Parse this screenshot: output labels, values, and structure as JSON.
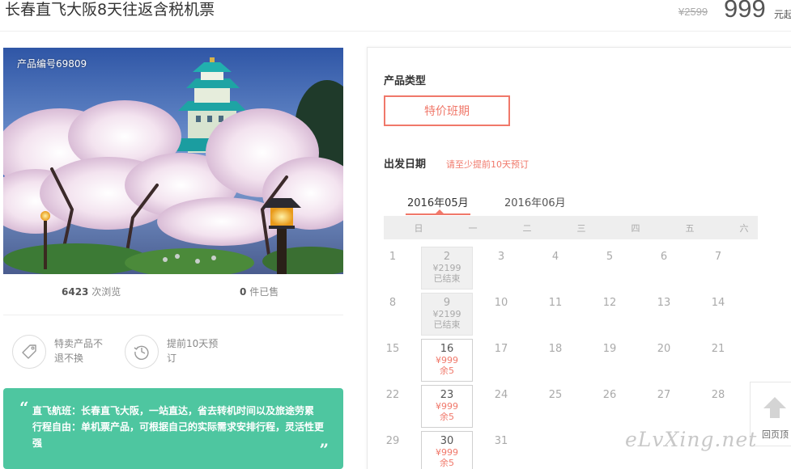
{
  "header": {
    "title": "长春直飞大阪8天往返含税机票",
    "price_original": "¥2599",
    "price_current": "999",
    "price_unit": "元起"
  },
  "gallery": {
    "product_id": "产品编号69809"
  },
  "stats": {
    "views_count": "6423",
    "views_label": "次浏览",
    "sold_count": "0",
    "sold_label": "件已售"
  },
  "features": [
    {
      "icon": "tag-icon",
      "text": "特卖产品不退不换"
    },
    {
      "icon": "clock-history-icon",
      "text": "提前10天预订"
    }
  ],
  "intro": {
    "open_quote": "“",
    "line1": "直飞航班：长春直飞大阪，一站直达，省去转机时间以及旅途劳累",
    "line2": "行程自由：单机票产品，可根据自己的实际需求安排行程，灵活性更强",
    "close_quote": "”",
    "bg_color": "#4ec6a0"
  },
  "booking": {
    "product_type_label": "产品类型",
    "product_type_option": "特价班期",
    "departure_label": "出发日期",
    "advance_notice": "请至少提前10天预订",
    "accent_color": "#f0786a",
    "months": [
      {
        "label": "2016年05月",
        "active": true
      },
      {
        "label": "2016年06月",
        "active": false
      }
    ],
    "weekdays": [
      "日",
      "一",
      "二",
      "三",
      "四",
      "五",
      "六"
    ],
    "days": [
      {
        "day": "1",
        "col": 0,
        "row": 0
      },
      {
        "day": "2",
        "col": 1,
        "row": 0,
        "price": "¥2199",
        "status": "已结束",
        "state": "ended"
      },
      {
        "day": "3",
        "col": 2,
        "row": 0
      },
      {
        "day": "4",
        "col": 3,
        "row": 0
      },
      {
        "day": "5",
        "col": 4,
        "row": 0
      },
      {
        "day": "6",
        "col": 5,
        "row": 0
      },
      {
        "day": "7",
        "col": 6,
        "row": 0
      },
      {
        "day": "8",
        "col": 0,
        "row": 1
      },
      {
        "day": "9",
        "col": 1,
        "row": 1,
        "price": "¥2199",
        "status": "已结束",
        "state": "ended"
      },
      {
        "day": "10",
        "col": 2,
        "row": 1
      },
      {
        "day": "11",
        "col": 3,
        "row": 1
      },
      {
        "day": "12",
        "col": 4,
        "row": 1
      },
      {
        "day": "13",
        "col": 5,
        "row": 1
      },
      {
        "day": "14",
        "col": 6,
        "row": 1
      },
      {
        "day": "15",
        "col": 0,
        "row": 2
      },
      {
        "day": "16",
        "col": 1,
        "row": 2,
        "price": "¥999",
        "status": "余5",
        "state": "avail"
      },
      {
        "day": "17",
        "col": 2,
        "row": 2
      },
      {
        "day": "18",
        "col": 3,
        "row": 2
      },
      {
        "day": "19",
        "col": 4,
        "row": 2
      },
      {
        "day": "20",
        "col": 5,
        "row": 2
      },
      {
        "day": "21",
        "col": 6,
        "row": 2
      },
      {
        "day": "22",
        "col": 0,
        "row": 3
      },
      {
        "day": "23",
        "col": 1,
        "row": 3,
        "price": "¥999",
        "status": "余5",
        "state": "avail"
      },
      {
        "day": "24",
        "col": 2,
        "row": 3
      },
      {
        "day": "25",
        "col": 3,
        "row": 3
      },
      {
        "day": "26",
        "col": 4,
        "row": 3
      },
      {
        "day": "27",
        "col": 5,
        "row": 3
      },
      {
        "day": "28",
        "col": 6,
        "row": 3
      },
      {
        "day": "29",
        "col": 0,
        "row": 4
      },
      {
        "day": "30",
        "col": 1,
        "row": 4,
        "price": "¥999",
        "status": "余5",
        "state": "avail"
      },
      {
        "day": "31",
        "col": 2,
        "row": 4
      }
    ]
  },
  "back_to_top": {
    "label": "回页顶",
    "icon": "arrow-up-icon"
  },
  "watermark": {
    "text": "eLvXing.net"
  }
}
